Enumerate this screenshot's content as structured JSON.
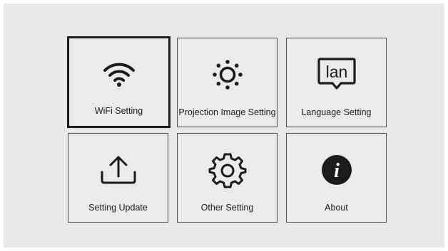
{
  "settings_menu": {
    "items": [
      {
        "id": "wifi",
        "label": "WiFi Setting",
        "icon": "wifi-icon",
        "selected": true
      },
      {
        "id": "projection",
        "label": "Projection Image Setting",
        "icon": "brightness-icon",
        "selected": false
      },
      {
        "id": "language",
        "label": "Language Setting",
        "icon": "lan-icon",
        "icon_text": "lan",
        "selected": false
      },
      {
        "id": "update",
        "label": "Setting Update",
        "icon": "upload-icon",
        "selected": false
      },
      {
        "id": "other",
        "label": "Other Setting",
        "icon": "gear-icon",
        "selected": false
      },
      {
        "id": "about",
        "label": "About",
        "icon": "info-icon",
        "icon_text": "i",
        "selected": false
      }
    ]
  },
  "colors": {
    "background": "#e9e9e9",
    "tile_border": "#4a4a4a",
    "selected_border": "#1c1c1c",
    "icon": "#1b1b1b"
  }
}
